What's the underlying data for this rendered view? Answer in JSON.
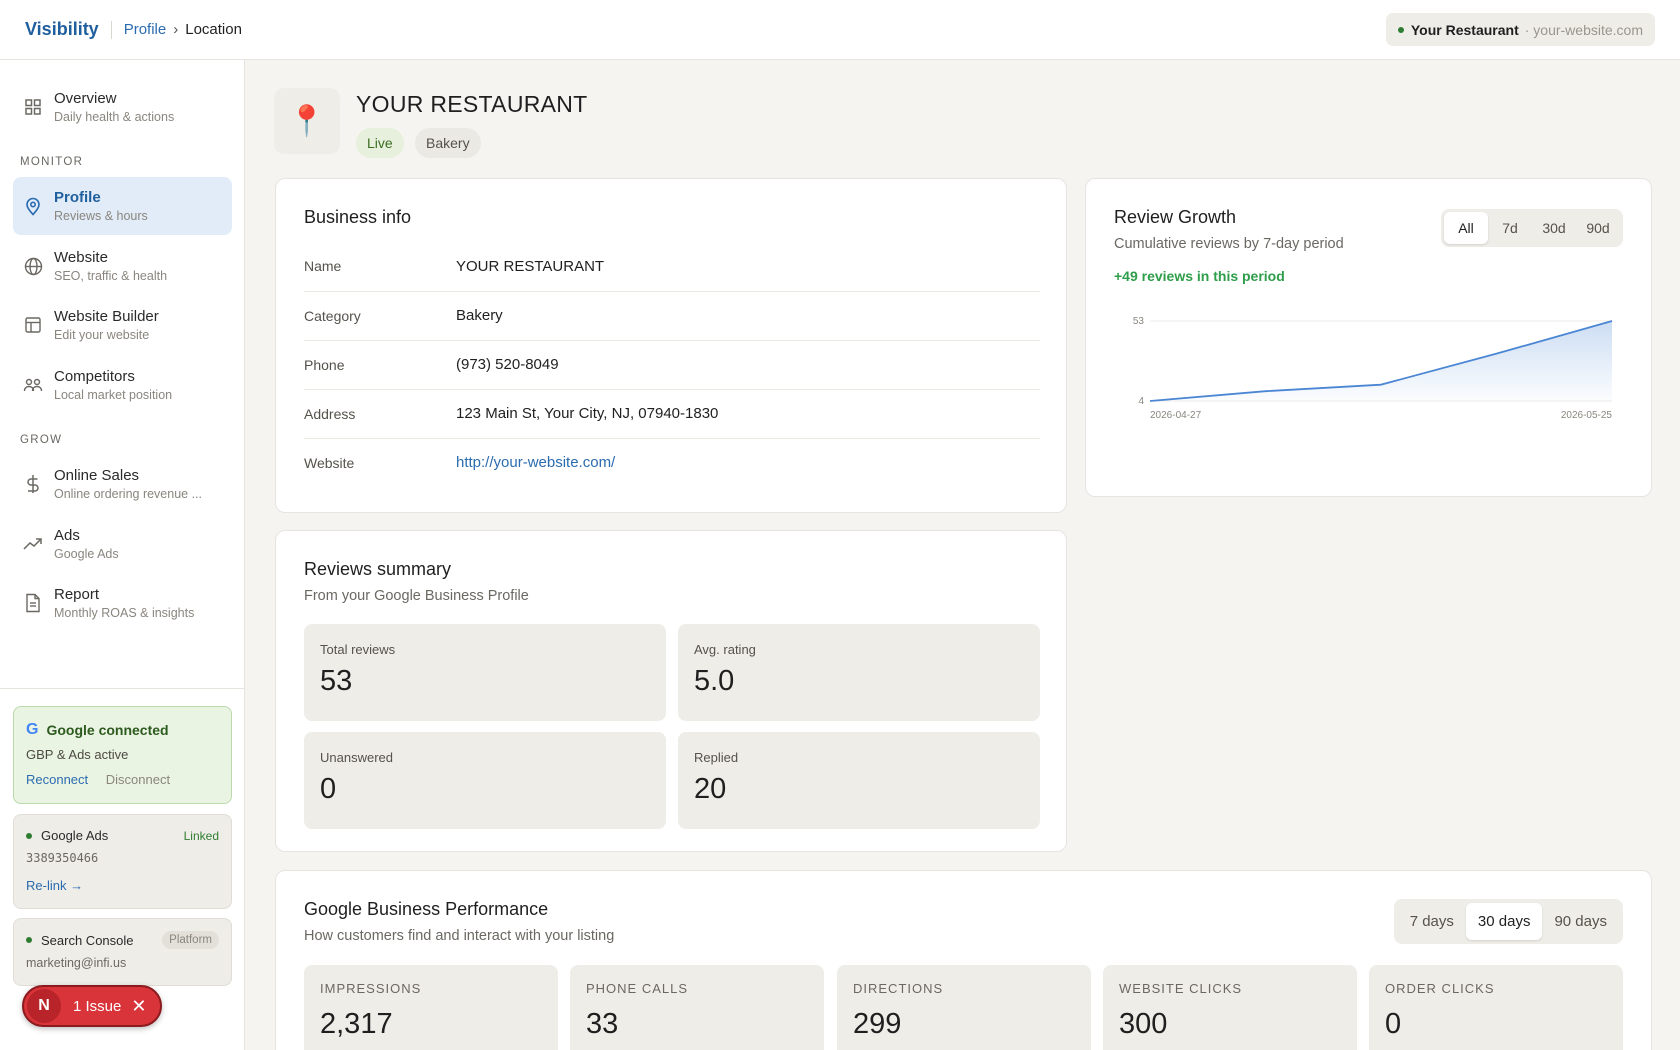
{
  "topbar": {
    "brand": "Visibility",
    "breadcrumb_parent": "Profile",
    "breadcrumb_arrow": "›",
    "breadcrumb_current": "Location",
    "site_name": "Your Restaurant",
    "site_url": "· your-website.com"
  },
  "sidebar": {
    "items": [
      {
        "title": "Overview",
        "subtitle": "Daily health & actions",
        "icon": "grid-icon"
      },
      {
        "title": "Profile",
        "subtitle": "Reviews & hours",
        "icon": "map-pin-icon",
        "active": true
      },
      {
        "title": "Website",
        "subtitle": "SEO, traffic & health",
        "icon": "globe-icon"
      },
      {
        "title": "Website Builder",
        "subtitle": "Edit your website",
        "icon": "layout-icon"
      },
      {
        "title": "Competitors",
        "subtitle": "Local market position",
        "icon": "users-icon"
      },
      {
        "title": "Online Sales",
        "subtitle": "Online ordering revenue ...",
        "icon": "dollar-icon"
      },
      {
        "title": "Ads",
        "subtitle": "Google Ads",
        "icon": "trending-up-icon"
      },
      {
        "title": "Report",
        "subtitle": "Monthly ROAS & insights",
        "icon": "file-icon"
      }
    ],
    "section_monitor": "MONITOR",
    "section_grow": "GROW",
    "google": {
      "logo": "G",
      "title": "Google connected",
      "subtitle": "GBP & Ads active",
      "reconnect": "Reconnect",
      "disconnect": "Disconnect"
    },
    "ads": {
      "title": "Google Ads",
      "status": "Linked",
      "account_id": "3389350466",
      "relink": "Re-link →"
    },
    "search_console": {
      "title": "Search Console",
      "badge": "Platform",
      "email": "marketing@infi.us"
    },
    "issue": {
      "avatar": "N",
      "label": "1 Issue",
      "close": "✕"
    }
  },
  "header": {
    "pin": "📍",
    "title": "YOUR RESTAURANT",
    "status_tag": "Live",
    "category_tag": "Bakery"
  },
  "business_info": {
    "title": "Business info",
    "rows": [
      {
        "label": "Name",
        "value": "YOUR RESTAURANT"
      },
      {
        "label": "Category",
        "value": "Bakery"
      },
      {
        "label": "Phone",
        "value": "(973) 520-8049"
      },
      {
        "label": "Address",
        "value": "123 Main St, Your City, NJ, 07940-1830"
      },
      {
        "label": "Website",
        "value": "http://your-website.com/"
      }
    ]
  },
  "review_growth": {
    "title": "Review Growth",
    "subtitle": "Cumulative reviews by 7-day period",
    "delta": "+49 reviews in this period",
    "ranges": [
      "All",
      "7d",
      "30d",
      "90d"
    ],
    "active_range": "All",
    "y_ticks": [
      "53",
      "4"
    ],
    "x_ticks": [
      "2026-04-27",
      "2026-05-25"
    ],
    "line_color": "#4a86d4"
  },
  "chart_data": {
    "type": "area",
    "x": [
      "2026-04-27",
      "2026-05-04",
      "2026-05-11",
      "2026-05-18",
      "2026-05-25"
    ],
    "values": [
      4,
      10,
      14,
      33,
      53
    ],
    "ylim": [
      4,
      53
    ],
    "title": "Review Growth",
    "xlabel": "",
    "ylabel": "",
    "grid": true
  },
  "reviews_summary": {
    "title": "Reviews summary",
    "subtitle": "From your Google Business Profile",
    "stats": [
      {
        "label": "Total reviews",
        "value": "53"
      },
      {
        "label": "Avg. rating",
        "value": "5.0"
      },
      {
        "label": "Unanswered",
        "value": "0"
      },
      {
        "label": "Replied",
        "value": "20"
      }
    ]
  },
  "performance": {
    "title": "Google Business Performance",
    "subtitle": "How customers find and interact with your listing",
    "ranges": [
      "7 days",
      "30 days",
      "90 days"
    ],
    "active_range": "30 days",
    "stats": [
      {
        "label": "IMPRESSIONS",
        "value": "2,317"
      },
      {
        "label": "PHONE CALLS",
        "value": "33"
      },
      {
        "label": "DIRECTIONS",
        "value": "299"
      },
      {
        "label": "WEBSITE CLICKS",
        "value": "300"
      },
      {
        "label": "ORDER CLICKS",
        "value": "0"
      }
    ]
  }
}
